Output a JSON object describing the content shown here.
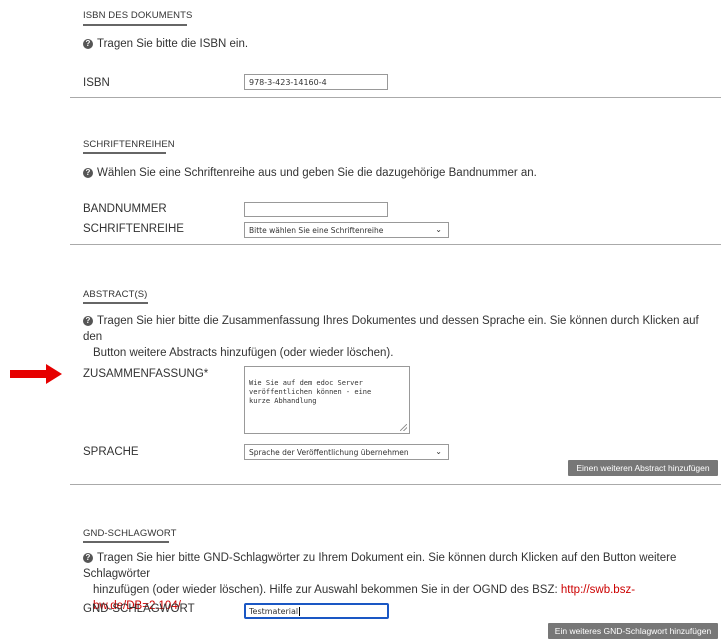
{
  "isbn_section": {
    "heading": "ISBN DES DOKUMENTS",
    "help": "Tragen Sie bitte die ISBN ein.",
    "label": "ISBN",
    "value": "978-3-423-14160-4"
  },
  "series_section": {
    "heading": "SCHRIFTENREIHEN",
    "help": "Wählen Sie eine Schriftenreihe aus und geben Sie die dazugehörige Bandnummer an.",
    "volume_label": "BANDNUMMER",
    "volume_value": "",
    "series_label": "SCHRIFTENREIHE",
    "series_selected": "Bitte wählen Sie eine Schriftenreihe"
  },
  "abstract_section": {
    "heading": "ABSTRACT(S)",
    "help_line1": "Tragen Sie hier bitte die Zusammenfassung Ihres Dokumentes und dessen Sprache ein. Sie können durch Klicken auf den",
    "help_line2": "Button weitere Abstracts hinzufügen (oder wieder löschen).",
    "summary_label": "ZUSAMMENFASSUNG*",
    "summary_value": "Wie Sie auf dem edoc Server\nveröffentlichen können - eine\nkurze Abhandlung",
    "language_label": "SPRACHE",
    "language_selected": "Sprache der Veröffentlichung übernehmen",
    "add_button": "Einen weiteren Abstract hinzufügen"
  },
  "gnd_section": {
    "heading": "GND-SCHLAGWORT",
    "help_line1": "Tragen Sie hier bitte GND-Schlagwörter zu Ihrem Dokument ein. Sie können durch Klicken auf den Button weitere Schlagwörter",
    "help_line2_prefix": "hinzufügen (oder wieder löschen). Hilfe zur Auswahl bekommen Sie in der OGND des BSZ: ",
    "help_link": "http://swb.bsz-bw.de/DB=2.104/",
    "label": "GND-SCHLAGWORT",
    "value": "Testmaterial",
    "add_button": "Ein weiteres GND-Schlagwort hinzufügen"
  },
  "icons": {
    "help": "?",
    "chevron": "⌄"
  },
  "colors": {
    "arrow": "#e60000",
    "button": "#777777",
    "link": "#cc0000",
    "focus": "#1a57c4"
  }
}
